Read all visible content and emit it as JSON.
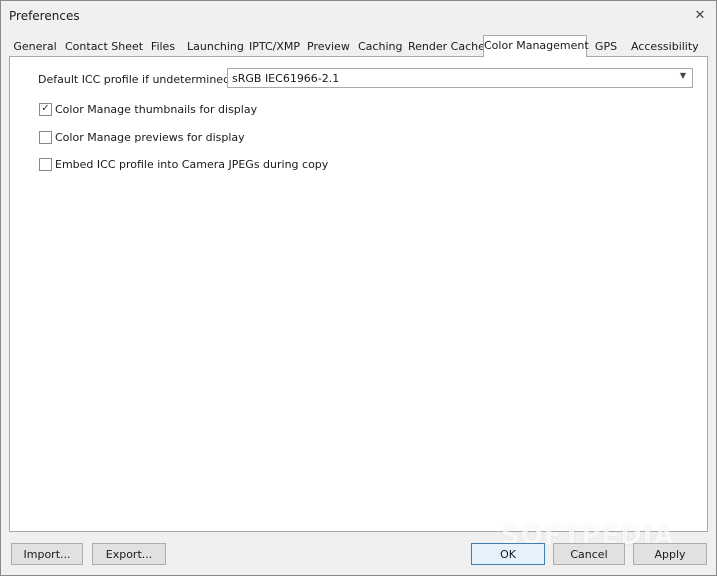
{
  "window": {
    "title": "Preferences"
  },
  "tabs": [
    {
      "label": "General"
    },
    {
      "label": "Contact Sheet"
    },
    {
      "label": "Files"
    },
    {
      "label": "Launching"
    },
    {
      "label": "IPTC/XMP"
    },
    {
      "label": "Preview"
    },
    {
      "label": "Caching"
    },
    {
      "label": "Render Cache"
    },
    {
      "label": "Color Management",
      "active": true
    },
    {
      "label": "GPS"
    },
    {
      "label": "Accessibility"
    }
  ],
  "color_management": {
    "icc_label": "Default ICC profile if undetermined:",
    "icc_value": "sRGB IEC61966-2.1",
    "options": [
      {
        "label": "Color Manage thumbnails for display",
        "checked": true
      },
      {
        "label": "Color Manage previews for display",
        "checked": false
      },
      {
        "label": "Embed ICC profile into Camera JPEGs during copy",
        "checked": false
      }
    ]
  },
  "buttons": {
    "import": "Import...",
    "export": "Export...",
    "ok": "OK",
    "cancel": "Cancel",
    "apply": "Apply"
  },
  "watermark": "SOFTPEDIA",
  "colors": {
    "accent": "#3c7fb1",
    "window_bg": "#f0f0f0",
    "panel_bg": "#ffffff"
  }
}
